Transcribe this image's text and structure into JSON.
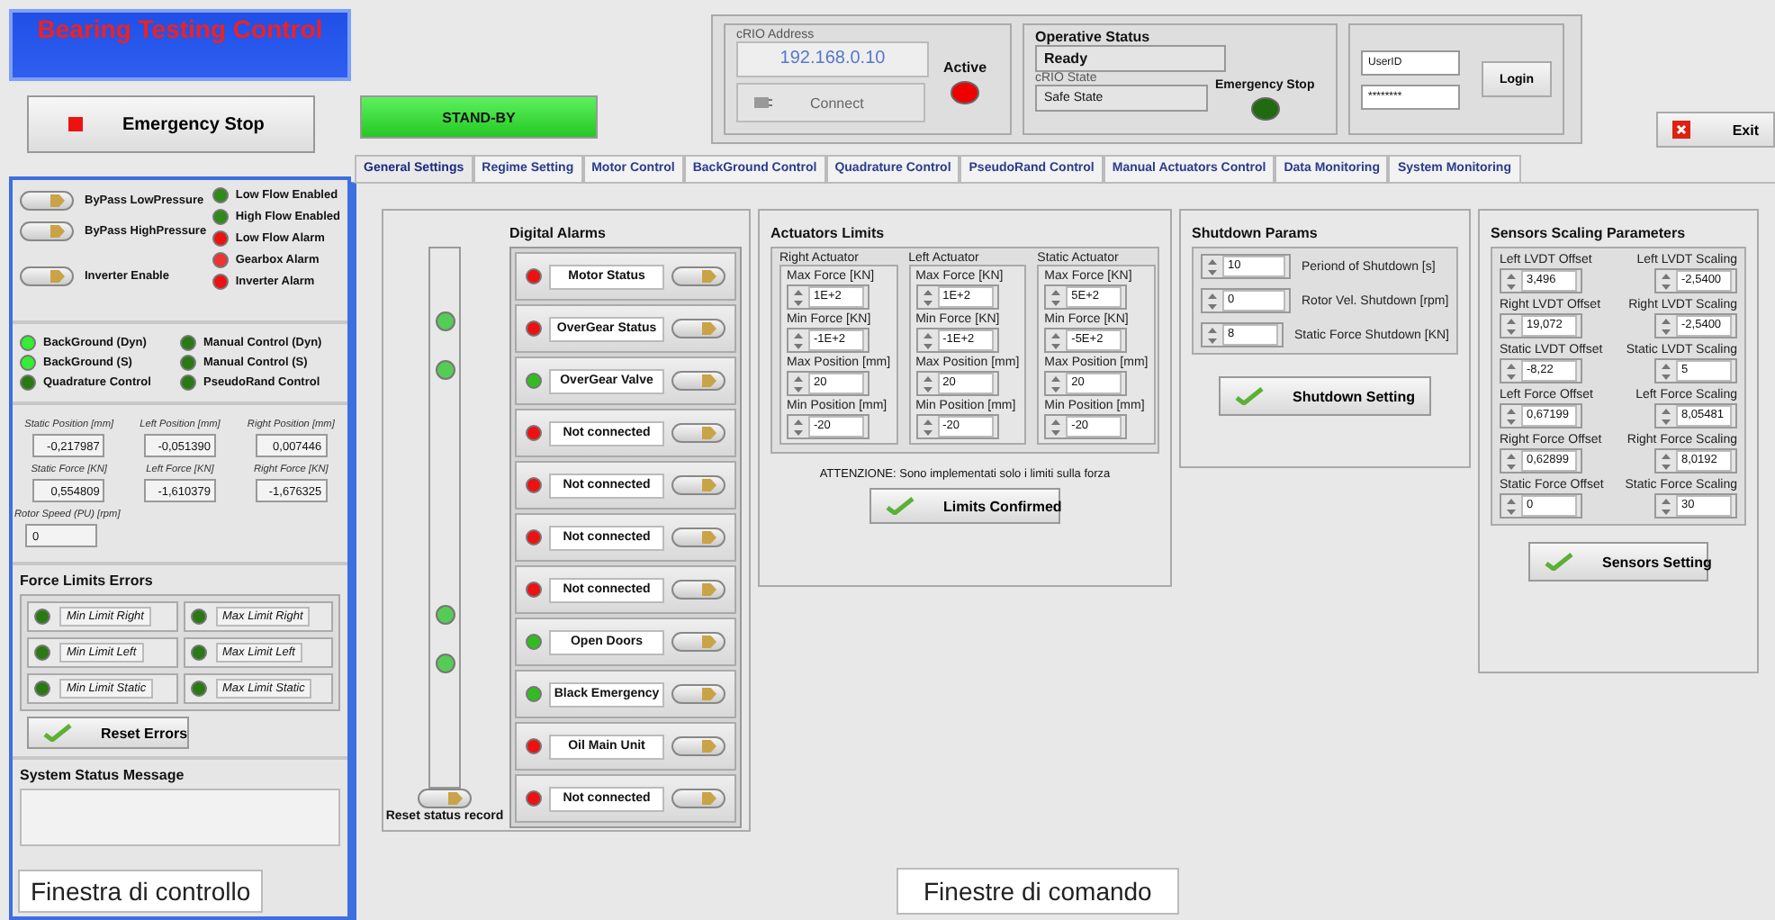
{
  "title": "Bearing Testing Control",
  "emergency_button": "Emergency Stop",
  "standby": {
    "label": "STAND-BY",
    "on": true
  },
  "crio": {
    "label": "cRIO Address",
    "address": "192.168.0.10",
    "connect": "Connect",
    "active_label": "Active",
    "active_on": true
  },
  "operative": {
    "label": "Operative Status",
    "value": "Ready",
    "state_label": "cRIO State",
    "state": "Safe State",
    "estop_label": "Emergency Stop",
    "estop_on": false
  },
  "login": {
    "user": "UserID",
    "password": "********",
    "button": "Login"
  },
  "exit_button": "Exit",
  "tabs": [
    {
      "label": "General Settings",
      "selected": true
    },
    {
      "label": "Regime Setting",
      "selected": false
    },
    {
      "label": "Motor Control",
      "selected": false
    },
    {
      "label": "BackGround Control",
      "selected": false
    },
    {
      "label": "Quadrature Control",
      "selected": false
    },
    {
      "label": "PseudoRand Control",
      "selected": false
    },
    {
      "label": "Manual Actuators Control",
      "selected": false
    },
    {
      "label": "Data Monitoring",
      "selected": false
    },
    {
      "label": "System Monitoring",
      "selected": false
    }
  ],
  "switches": [
    {
      "label": "ByPass LowPressure",
      "on": true
    },
    {
      "label": "ByPass HighPressure",
      "on": true
    },
    {
      "label": "Inverter Enable",
      "on": true
    }
  ],
  "alarms": [
    {
      "label": "Low Flow Enabled",
      "color": "#2f8a1a"
    },
    {
      "label": "High Flow Enabled",
      "color": "#2f8a1a"
    },
    {
      "label": "Low Flow Alarm",
      "color": "#ee1111"
    },
    {
      "label": "Gearbox Alarm",
      "color": "#ee3333"
    },
    {
      "label": "Inverter Alarm",
      "color": "#ee1111"
    }
  ],
  "modes": [
    {
      "label": "BackGround (Dyn)",
      "color": "#33ee33"
    },
    {
      "label": "Manual Control (Dyn)",
      "color": "#2a7a14"
    },
    {
      "label": "BackGround (S)",
      "color": "#33ee33"
    },
    {
      "label": "Manual Control (S)",
      "color": "#2a7a14"
    },
    {
      "label": "Quadrature Control",
      "color": "#2a7a14"
    },
    {
      "label": "PseudoRand Control",
      "color": "#2a7a14"
    }
  ],
  "readings": [
    {
      "label": "Static Position [mm]",
      "value": "-0,217987"
    },
    {
      "label": "Left Position [mm]",
      "value": "-0,051390"
    },
    {
      "label": "Right Position [mm]",
      "value": "0,007446"
    },
    {
      "label": "Static Force [KN]",
      "value": "0,554809"
    },
    {
      "label": "Left Force [KN]",
      "value": "-1,610379"
    },
    {
      "label": "Right Force [KN]",
      "value": "-1,676325"
    },
    {
      "label": "Rotor Speed (PU) [rpm]",
      "value": "0"
    }
  ],
  "force_limits": {
    "title": "Force Limits Errors",
    "items": [
      {
        "label": "Min Limit Right",
        "color": "#2a7a14"
      },
      {
        "label": "Max Limit Right",
        "color": "#2a7a14"
      },
      {
        "label": "Min Limit Left",
        "color": "#2a7a14"
      },
      {
        "label": "Max Limit Left",
        "color": "#2a7a14"
      },
      {
        "label": "Min Limit Static",
        "color": "#2a7a14"
      },
      {
        "label": "Max Limit Static",
        "color": "#2a7a14"
      }
    ],
    "button": "Reset Errors"
  },
  "system_status": {
    "label": "System Status Message"
  },
  "annotation_left": "Finestra di controllo",
  "digital_alarms": {
    "title": "Digital Alarms",
    "rows": [
      {
        "label": "Motor Status",
        "color": "#ee1111",
        "latched": false,
        "on": true
      },
      {
        "label": "OverGear Status",
        "color": "#ee1111",
        "latched": true,
        "on": true
      },
      {
        "label": "OverGear Valve",
        "color": "#33bb22",
        "latched": true,
        "on": true
      },
      {
        "label": "Not connected",
        "color": "#ee1111",
        "latched": false,
        "on": true
      },
      {
        "label": "Not connected",
        "color": "#ee1111",
        "latched": false,
        "on": true
      },
      {
        "label": "Not connected",
        "color": "#ee1111",
        "latched": false,
        "on": true
      },
      {
        "label": "Not connected",
        "color": "#ee1111",
        "latched": false,
        "on": true
      },
      {
        "label": "Open Doors",
        "color": "#33bb22",
        "latched": true,
        "on": true
      },
      {
        "label": "Black Emergency",
        "color": "#33bb22",
        "latched": true,
        "on": true
      },
      {
        "label": "Oil Main Unit",
        "color": "#ee1111",
        "latched": false,
        "on": true
      },
      {
        "label": "Not connected",
        "color": "#ee1111",
        "latched": false,
        "on": true
      }
    ],
    "reset": "Reset status record",
    "reset_on": true
  },
  "actuators": {
    "title": "Actuators Limits",
    "groups": [
      {
        "name": "Right Actuator",
        "fields": [
          {
            "label": "Max Force [KN]",
            "value": "1E+2"
          },
          {
            "label": "Min Force [KN]",
            "value": "-1E+2"
          },
          {
            "label": "Max Position [mm]",
            "value": "20"
          },
          {
            "label": "Min Position [mm]",
            "value": "-20"
          }
        ]
      },
      {
        "name": "Left Actuator",
        "fields": [
          {
            "label": "Max Force [KN]",
            "value": "1E+2"
          },
          {
            "label": "Min Force [KN]",
            "value": "-1E+2"
          },
          {
            "label": "Max Position [mm]",
            "value": "20"
          },
          {
            "label": "Min Position [mm]",
            "value": "-20"
          }
        ]
      },
      {
        "name": "Static Actuator",
        "fields": [
          {
            "label": "Max Force [KN]",
            "value": "5E+2"
          },
          {
            "label": "Min Force [KN]",
            "value": "-5E+2"
          },
          {
            "label": "Max Position [mm]",
            "value": "20"
          },
          {
            "label": "Min Position [mm]",
            "value": "-20"
          }
        ]
      }
    ],
    "note": "ATTENZIONE: Sono implementati solo i limiti sulla forza",
    "button": "Limits Confirmed"
  },
  "shutdown": {
    "title": "Shutdown Params",
    "params": [
      {
        "value": "10",
        "label": "Periond of Shutdown [s]"
      },
      {
        "value": "0",
        "label": "Rotor Vel. Shutdown [rpm]"
      },
      {
        "value": "8",
        "label": "Static Force Shutdown [KN]"
      }
    ],
    "button": "Shutdown Setting"
  },
  "sensors": {
    "title": "Sensors Scaling Parameters",
    "params": [
      {
        "label": "Left LVDT Offset",
        "value": "3,496"
      },
      {
        "label": "Left LVDT Scaling",
        "value": "-2,5400"
      },
      {
        "label": "Right LVDT Offset",
        "value": "19,072"
      },
      {
        "label": "Right LVDT Scaling",
        "value": "-2,5400"
      },
      {
        "label": "Static LVDT Offset",
        "value": "-8,22"
      },
      {
        "label": "Static LVDT Scaling",
        "value": "5"
      },
      {
        "label": "Left Force Offset",
        "value": "0,67199"
      },
      {
        "label": "Left Force Scaling",
        "value": "8,05481"
      },
      {
        "label": "Right Force Offset",
        "value": "0,62899"
      },
      {
        "label": "Right Force Scaling",
        "value": "8,0192"
      },
      {
        "label": "Static Force Offset",
        "value": "0"
      },
      {
        "label": "Static Force Scaling",
        "value": "30"
      }
    ],
    "button": "Sensors Setting"
  },
  "annotation_main": "Finestre di comando"
}
